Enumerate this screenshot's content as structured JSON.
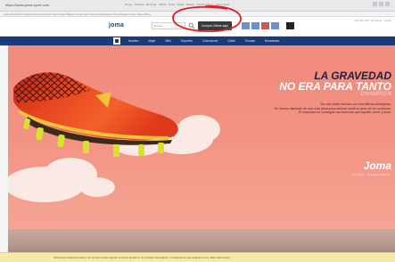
{
  "browser": {
    "url_text": "https://www.joma-sport.com",
    "tabs_text": "Home · Noticias · Running · Fútbol · Tenis · Padel · Basket · Tienda Online · Joma Sport",
    "bookmarks_text": "Apps  Mail  Drive  Noticias  Running  Fútbol  Tenis  Padel  Basket  Joma Sport  Tienda  Calendario  Clima  Mapas  Fotos  Videos  Blog"
  },
  "header": {
    "logo": "joma",
    "search_placeholder": "Buscar",
    "promo_button": "Compra Online aquí",
    "right_text": "ES | EN | FR · Mi cuenta · Carrito"
  },
  "nav": {
    "items": [
      "Hombre",
      "Mujer",
      "Niño",
      "Deportes",
      "Colecciones",
      "Outlet",
      "Tiendas",
      "Novedades"
    ]
  },
  "hero": {
    "headline_1": "LA GRAVEDAD",
    "headline_2": "NO ERA PARA TANTO",
    "product_name": "CHAMPION",
    "copy_lines": [
      "No sólo están hechas con microfibras ultraligeras.",
      "Se hemos diseñado de una sola pieza para ahorrar hasta el peso de los cordones.",
      "El resultado es conseguir ese flow tras que aquello correr y subir."
    ],
    "brand_mark": "Joma",
    "brand_sub": "Joma Sport · Champion Collection"
  },
  "bottom_bar": {
    "text": "Utilizamos cookies propias y de terceros para mejorar nuestros servicios. Si continúa navegando, consideramos que acepta su uso. Más información"
  },
  "colors": {
    "nav_bg": "#1a3a78",
    "hero_bg": "#f08a7c",
    "annotation": "#e02020",
    "boot_primary": "#e83a1f",
    "boot_accent": "#e8c73a"
  }
}
